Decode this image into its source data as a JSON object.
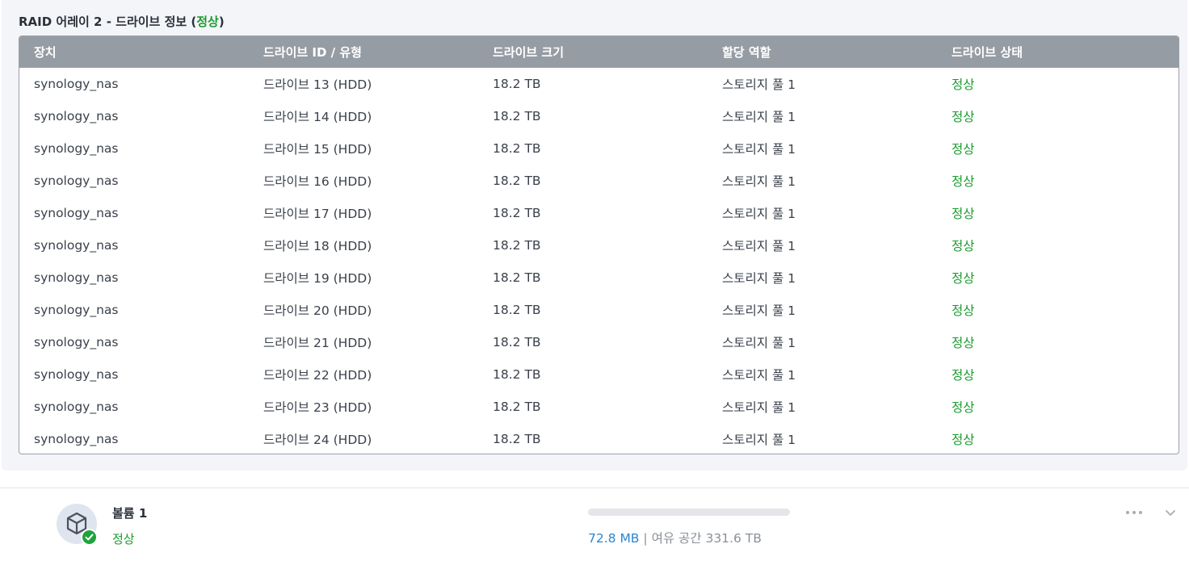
{
  "raid": {
    "title_prefix": "RAID 어레이 2 - 드라이브 정보 (",
    "title_status": "정상",
    "title_suffix": ")",
    "columns": [
      "장치",
      "드라이브 ID / 유형",
      "드라이브 크기",
      "할당 역할",
      "드라이브 상태"
    ],
    "rows": [
      {
        "device": "synology_nas",
        "drive": "드라이브 13 (HDD)",
        "size": "18.2 TB",
        "role": "스토리지 풀 1",
        "status": "정상"
      },
      {
        "device": "synology_nas",
        "drive": "드라이브 14 (HDD)",
        "size": "18.2 TB",
        "role": "스토리지 풀 1",
        "status": "정상"
      },
      {
        "device": "synology_nas",
        "drive": "드라이브 15 (HDD)",
        "size": "18.2 TB",
        "role": "스토리지 풀 1",
        "status": "정상"
      },
      {
        "device": "synology_nas",
        "drive": "드라이브 16 (HDD)",
        "size": "18.2 TB",
        "role": "스토리지 풀 1",
        "status": "정상"
      },
      {
        "device": "synology_nas",
        "drive": "드라이브 17 (HDD)",
        "size": "18.2 TB",
        "role": "스토리지 풀 1",
        "status": "정상"
      },
      {
        "device": "synology_nas",
        "drive": "드라이브 18 (HDD)",
        "size": "18.2 TB",
        "role": "스토리지 풀 1",
        "status": "정상"
      },
      {
        "device": "synology_nas",
        "drive": "드라이브 19 (HDD)",
        "size": "18.2 TB",
        "role": "스토리지 풀 1",
        "status": "정상"
      },
      {
        "device": "synology_nas",
        "drive": "드라이브 20 (HDD)",
        "size": "18.2 TB",
        "role": "스토리지 풀 1",
        "status": "정상"
      },
      {
        "device": "synology_nas",
        "drive": "드라이브 21 (HDD)",
        "size": "18.2 TB",
        "role": "스토리지 풀 1",
        "status": "정상"
      },
      {
        "device": "synology_nas",
        "drive": "드라이브 22 (HDD)",
        "size": "18.2 TB",
        "role": "스토리지 풀 1",
        "status": "정상"
      },
      {
        "device": "synology_nas",
        "drive": "드라이브 23 (HDD)",
        "size": "18.2 TB",
        "role": "스토리지 풀 1",
        "status": "정상"
      },
      {
        "device": "synology_nas",
        "drive": "드라이브 24 (HDD)",
        "size": "18.2 TB",
        "role": "스토리지 풀 1",
        "status": "정상"
      }
    ]
  },
  "volume": {
    "name": "볼륨 1",
    "status": "정상",
    "used": "72.8 MB",
    "separator": "|",
    "free_label": "여유 공간 331.6 TB",
    "usage_fraction": 0.0002,
    "icon": "volume-cube-icon",
    "badge_icon": "check-icon"
  },
  "colors": {
    "ok_green": "#1a9c2e",
    "header_gray": "#969ca4",
    "link_blue": "#2a86d1"
  }
}
